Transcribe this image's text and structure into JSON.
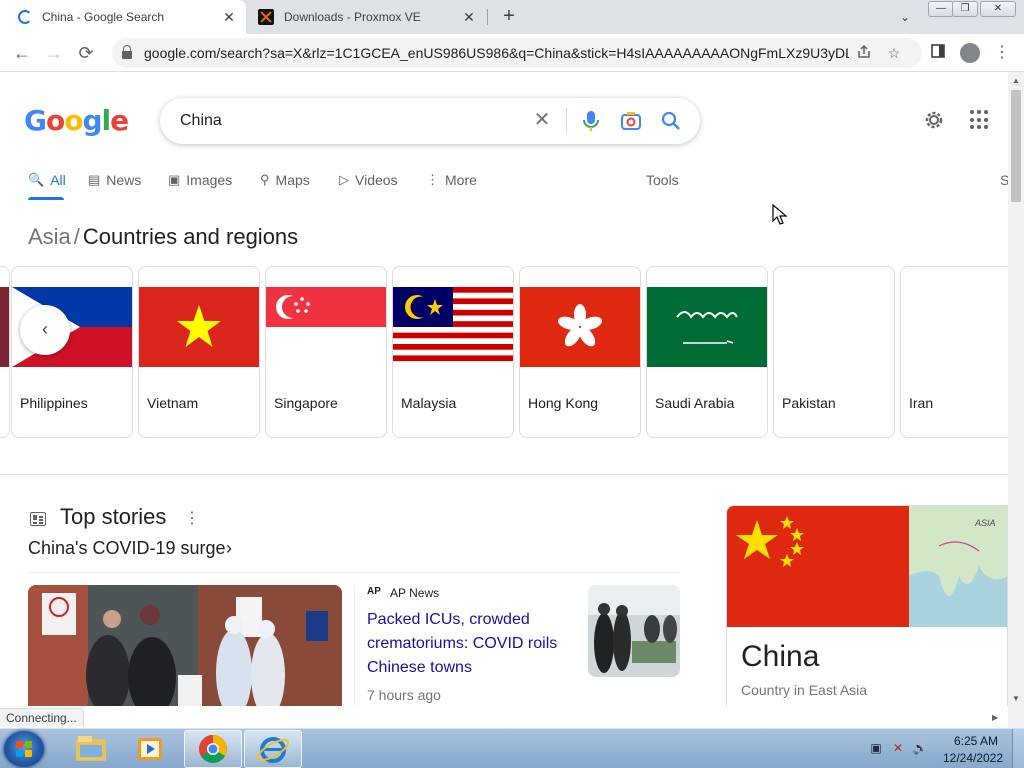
{
  "browser": {
    "tabs": [
      {
        "title": "China - Google Search",
        "close": "✕"
      },
      {
        "title": "Downloads - Proxmox VE",
        "close": "✕"
      }
    ],
    "new_tab": "+",
    "tab_search": "⌄",
    "window_controls": {
      "minimize": "—",
      "maximize": "❐",
      "close": "✕"
    },
    "url": "google.com/search?sa=X&rlz=1C1GCEA_enUS986US986&q=China&stick=H4sIAAAAAAAAAONgFmLXz9U3yDLI...",
    "back": "←",
    "forward": "→",
    "reload": "⟳"
  },
  "google": {
    "logo_letters": [
      {
        "ch": "G",
        "color": "#4285f4"
      },
      {
        "ch": "o",
        "color": "#ea4335"
      },
      {
        "ch": "o",
        "color": "#fbbc05"
      },
      {
        "ch": "g",
        "color": "#4285f4"
      },
      {
        "ch": "l",
        "color": "#34a853"
      },
      {
        "ch": "e",
        "color": "#ea4335"
      }
    ],
    "search_value": "China",
    "clear": "✕",
    "tabs": [
      {
        "label": "All",
        "icon": "🔍"
      },
      {
        "label": "News",
        "icon": "▤"
      },
      {
        "label": "Images",
        "icon": "▣"
      },
      {
        "label": "Maps",
        "icon": "⚲"
      },
      {
        "label": "Videos",
        "icon": "▷"
      },
      {
        "label": "More",
        "icon": "⋮"
      }
    ],
    "tools": "Tools",
    "tab_cut": "S"
  },
  "breadcrumb": {
    "parent": "Asia",
    "sep": "/",
    "current": "Countries and regions"
  },
  "countries": [
    {
      "name": "Philippines"
    },
    {
      "name": "Vietnam"
    },
    {
      "name": "Singapore"
    },
    {
      "name": "Malaysia"
    },
    {
      "name": "Hong Kong"
    },
    {
      "name": "Saudi Arabia"
    },
    {
      "name": "Pakistan"
    },
    {
      "name": "Iran"
    }
  ],
  "carousel_prev": "‹",
  "top_stories": {
    "title": "Top stories",
    "more": "⋮",
    "subtitle": "China's COVID-19 surge",
    "chevron": "›",
    "story": {
      "ap_logo": "AP",
      "source": "AP News",
      "headline": "Packed ICUs, crowded crematoriums: COVID roils Chinese towns",
      "time": "7 hours ago"
    }
  },
  "knowledge_panel": {
    "title": "China",
    "description": "Country in East Asia",
    "map_label": "ASIA"
  },
  "status": "Connecting...",
  "taskbar": {
    "time": "6:25 AM",
    "date": "12/24/2022"
  },
  "icons": [
    "loading-spinner-icon",
    "proxmox-icon",
    "lock-icon",
    "share-icon",
    "star-icon",
    "sidepanel-icon",
    "profile-icon",
    "menu-icon",
    "mic-icon",
    "camera-icon",
    "search-icon",
    "gear-icon",
    "apps-icon"
  ]
}
